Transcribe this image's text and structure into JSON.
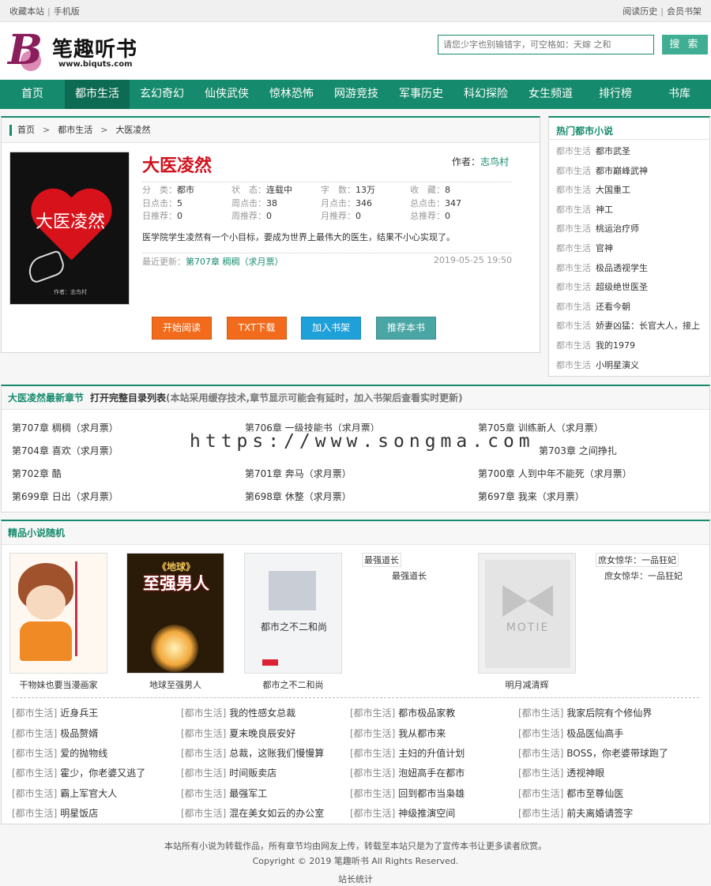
{
  "topbar": {
    "fav": "收藏本站",
    "mobile": "手机版",
    "history": "阅读历史",
    "member": "会员书架",
    "sep": "|"
  },
  "logo": {
    "letter": "B",
    "name": "笔趣听书",
    "url": "www.biquts.com"
  },
  "search": {
    "placeholder": "请您少字也别输错字，可空格如：天嫁 之和",
    "button": "搜 索"
  },
  "nav": [
    "首页",
    "都市生活",
    "玄幻奇幻",
    "仙侠武侠",
    "惊林恐怖",
    "网游竞技",
    "军事历史",
    "科幻探险",
    "女生频道",
    "排行榜",
    "书库"
  ],
  "crumb": [
    "首页",
    "都市生活",
    "大医凌然"
  ],
  "crumb_sep": ">",
  "book": {
    "cover_title": "大医凌然",
    "cover_author": "作者：志鸟村",
    "title": "大医凌然",
    "author_label": "作者：",
    "author": "志鸟村",
    "meta": [
      [
        [
          "分　类：",
          "都市"
        ],
        [
          "状　态：",
          "连载中"
        ],
        [
          "字　数：",
          "13万"
        ],
        [
          "收　藏：",
          "8"
        ]
      ],
      [
        [
          "日点击：",
          "5"
        ],
        [
          "周点击：",
          "38"
        ],
        [
          "月点击：",
          "346"
        ],
        [
          "总点击：",
          "347"
        ]
      ],
      [
        [
          "日推荐：",
          "0"
        ],
        [
          "周推荐：",
          "0"
        ],
        [
          "月推荐：",
          "0"
        ],
        [
          "总推荐：",
          "0"
        ]
      ]
    ],
    "desc": "医学院学生凌然有一个小目标，要成为世界上最伟大的医生，结果不小心实现了。",
    "latest_label": "最近更新：",
    "latest": "第707章 稠稠（求月票）",
    "date": "2019-05-25 19:50"
  },
  "buttons": [
    {
      "label": "开始阅读",
      "color": "#f26a1b"
    },
    {
      "label": "TXT下载",
      "color": "#f26a1b"
    },
    {
      "label": "加入书架",
      "color": "#1ea0d8"
    },
    {
      "label": "推荐本书",
      "color": "#4aa5a5"
    }
  ],
  "hot": {
    "title": "热门都市小说",
    "items": [
      [
        "都市生活",
        "都市武圣"
      ],
      [
        "都市生活",
        "都市巅峰武神"
      ],
      [
        "都市生活",
        "大国重工"
      ],
      [
        "都市生活",
        "神工"
      ],
      [
        "都市生活",
        "桃运治疗师"
      ],
      [
        "都市生活",
        "官神"
      ],
      [
        "都市生活",
        "极品透视学生"
      ],
      [
        "都市生活",
        "超级绝世医圣"
      ],
      [
        "都市生活",
        "还看今朝"
      ],
      [
        "都市生活",
        "娇妻凶猛：长官大人，接上"
      ],
      [
        "都市生活",
        "我的1979"
      ],
      [
        "都市生活",
        "小明星演义"
      ]
    ]
  },
  "chapters": {
    "title": "大医凌然最新章节",
    "link": "打开完整目录列表",
    "note": "(本站采用缓存技术,章节显示可能会有延时，加入书架后查看实时更新)",
    "items": [
      "第707章 稠稠（求月票）",
      "第706章 一级技能书（求月票）",
      "第705章 训练新人（求月票）",
      "第704章 喜欢（求月票）",
      "",
      "第703章 之间挣扎",
      "第702章 酷",
      "第701章 奔马（求月票）",
      "第700章 人到中年不能死（求月票）",
      "第699章 日出（求月票）",
      "第698章 休整（求月票）",
      "第697章 我来（求月票）"
    ]
  },
  "watermark": "https://www.songma.com",
  "featured": {
    "title": "精品小说随机",
    "books": [
      {
        "caption": "干物妹也要当漫画家"
      },
      {
        "caption": "地球至强男人",
        "cover_small": "《地球》",
        "cover_big": "至强男人"
      },
      {
        "caption": "都市之不二和尚",
        "cover_text": "都市之不二和尚"
      },
      {
        "caption": "明月减清辉",
        "cover_text": "MOTIE"
      }
    ],
    "alts": [
      {
        "tag": "最强道长",
        "caption": "最强道长"
      },
      {
        "tag": "庶女惊华：一品狂妃",
        "caption": "庶女惊华：一品狂妃"
      }
    ],
    "list": [
      [
        "[都市生活]",
        "近身兵王"
      ],
      [
        "[都市生活]",
        "我的性感女总裁"
      ],
      [
        "[都市生活]",
        "都市极品家教"
      ],
      [
        "[都市生活]",
        "我家后院有个修仙界"
      ],
      [
        "[都市生活]",
        "极品赘婿"
      ],
      [
        "[都市生活]",
        "夏末晚良辰安好"
      ],
      [
        "[都市生活]",
        "我从都市来"
      ],
      [
        "[都市生活]",
        "极品医仙高手"
      ],
      [
        "[都市生活]",
        "爱的抛物线"
      ],
      [
        "[都市生活]",
        "总裁，这账我们慢慢算"
      ],
      [
        "[都市生活]",
        "主妇的升值计划"
      ],
      [
        "[都市生活]",
        "BOSS，你老婆带球跑了"
      ],
      [
        "[都市生活]",
        "霍少，你老婆又逃了"
      ],
      [
        "[都市生活]",
        "时间贩卖店"
      ],
      [
        "[都市生活]",
        "泡妞高手在都市"
      ],
      [
        "[都市生活]",
        "透视神眼"
      ],
      [
        "[都市生活]",
        "霸上军官大人"
      ],
      [
        "[都市生活]",
        "最强军工"
      ],
      [
        "[都市生活]",
        "回到都市当枭雄"
      ],
      [
        "[都市生活]",
        "都市至尊仙医"
      ],
      [
        "[都市生活]",
        "明星饭店"
      ],
      [
        "[都市生活]",
        "混在美女如云的办公室"
      ],
      [
        "[都市生活]",
        "神级推演空间"
      ],
      [
        "[都市生活]",
        "前夫离婚请签字"
      ]
    ]
  },
  "footer": {
    "line1": "本站所有小说为转载作品，所有章节均由网友上传，转载至本站只是为了宣传本书让更多读者欣赏。",
    "line2": "Copyright © 2019 笔趣听书 All Rights Reserved.",
    "line3": "站长统计"
  },
  "colors": {
    "brand": "#158a6c",
    "title_red": "#d0121e"
  }
}
